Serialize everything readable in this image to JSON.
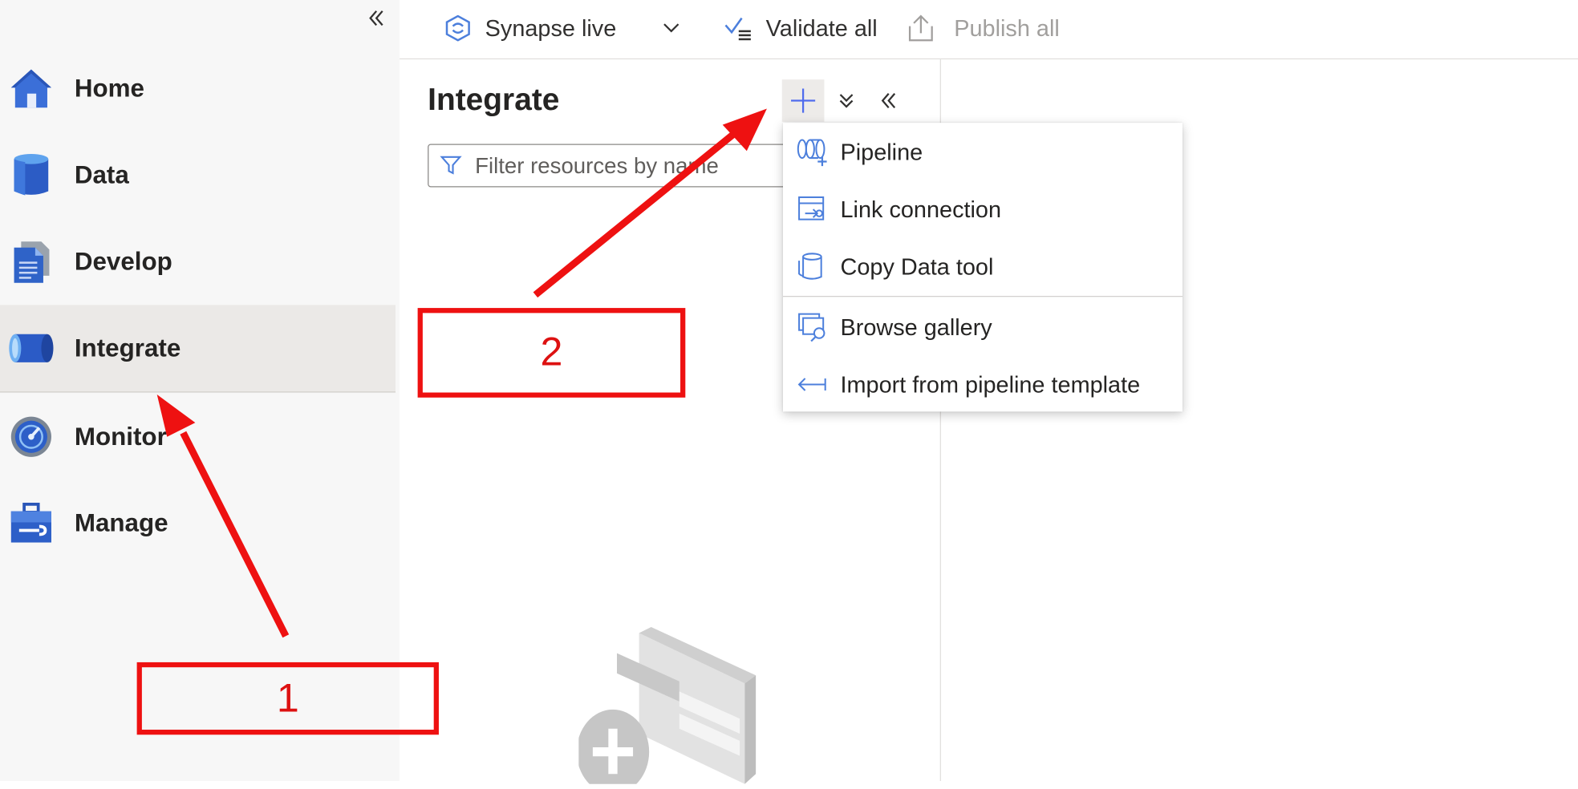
{
  "toolbar": {
    "branch_label": "Synapse live",
    "validate_label": "Validate all",
    "publish_label": "Publish all"
  },
  "sidebar": {
    "items": [
      {
        "label": "Home",
        "icon": "home-icon"
      },
      {
        "label": "Data",
        "icon": "database-icon"
      },
      {
        "label": "Develop",
        "icon": "document-icon"
      },
      {
        "label": "Integrate",
        "icon": "pipe-icon",
        "active": true
      },
      {
        "label": "Monitor",
        "icon": "gauge-icon"
      },
      {
        "label": "Manage",
        "icon": "toolbox-icon"
      }
    ]
  },
  "panel": {
    "title": "Integrate",
    "filter_placeholder": "Filter resources by name"
  },
  "add_menu": {
    "items": [
      {
        "label": "Pipeline",
        "icon": "pipeline-icon"
      },
      {
        "label": "Link connection",
        "icon": "link-connection-icon"
      },
      {
        "label": "Copy Data tool",
        "icon": "copy-data-icon"
      },
      {
        "label": "Browse gallery",
        "icon": "gallery-icon"
      },
      {
        "label": "Import from pipeline template",
        "icon": "import-icon"
      }
    ]
  },
  "annotations": {
    "step1": "1",
    "step2": "2"
  },
  "colors": {
    "accent": "#4f6bed",
    "annotation_red": "#ee1111",
    "active_nav_bg": "#ebe9e7"
  }
}
